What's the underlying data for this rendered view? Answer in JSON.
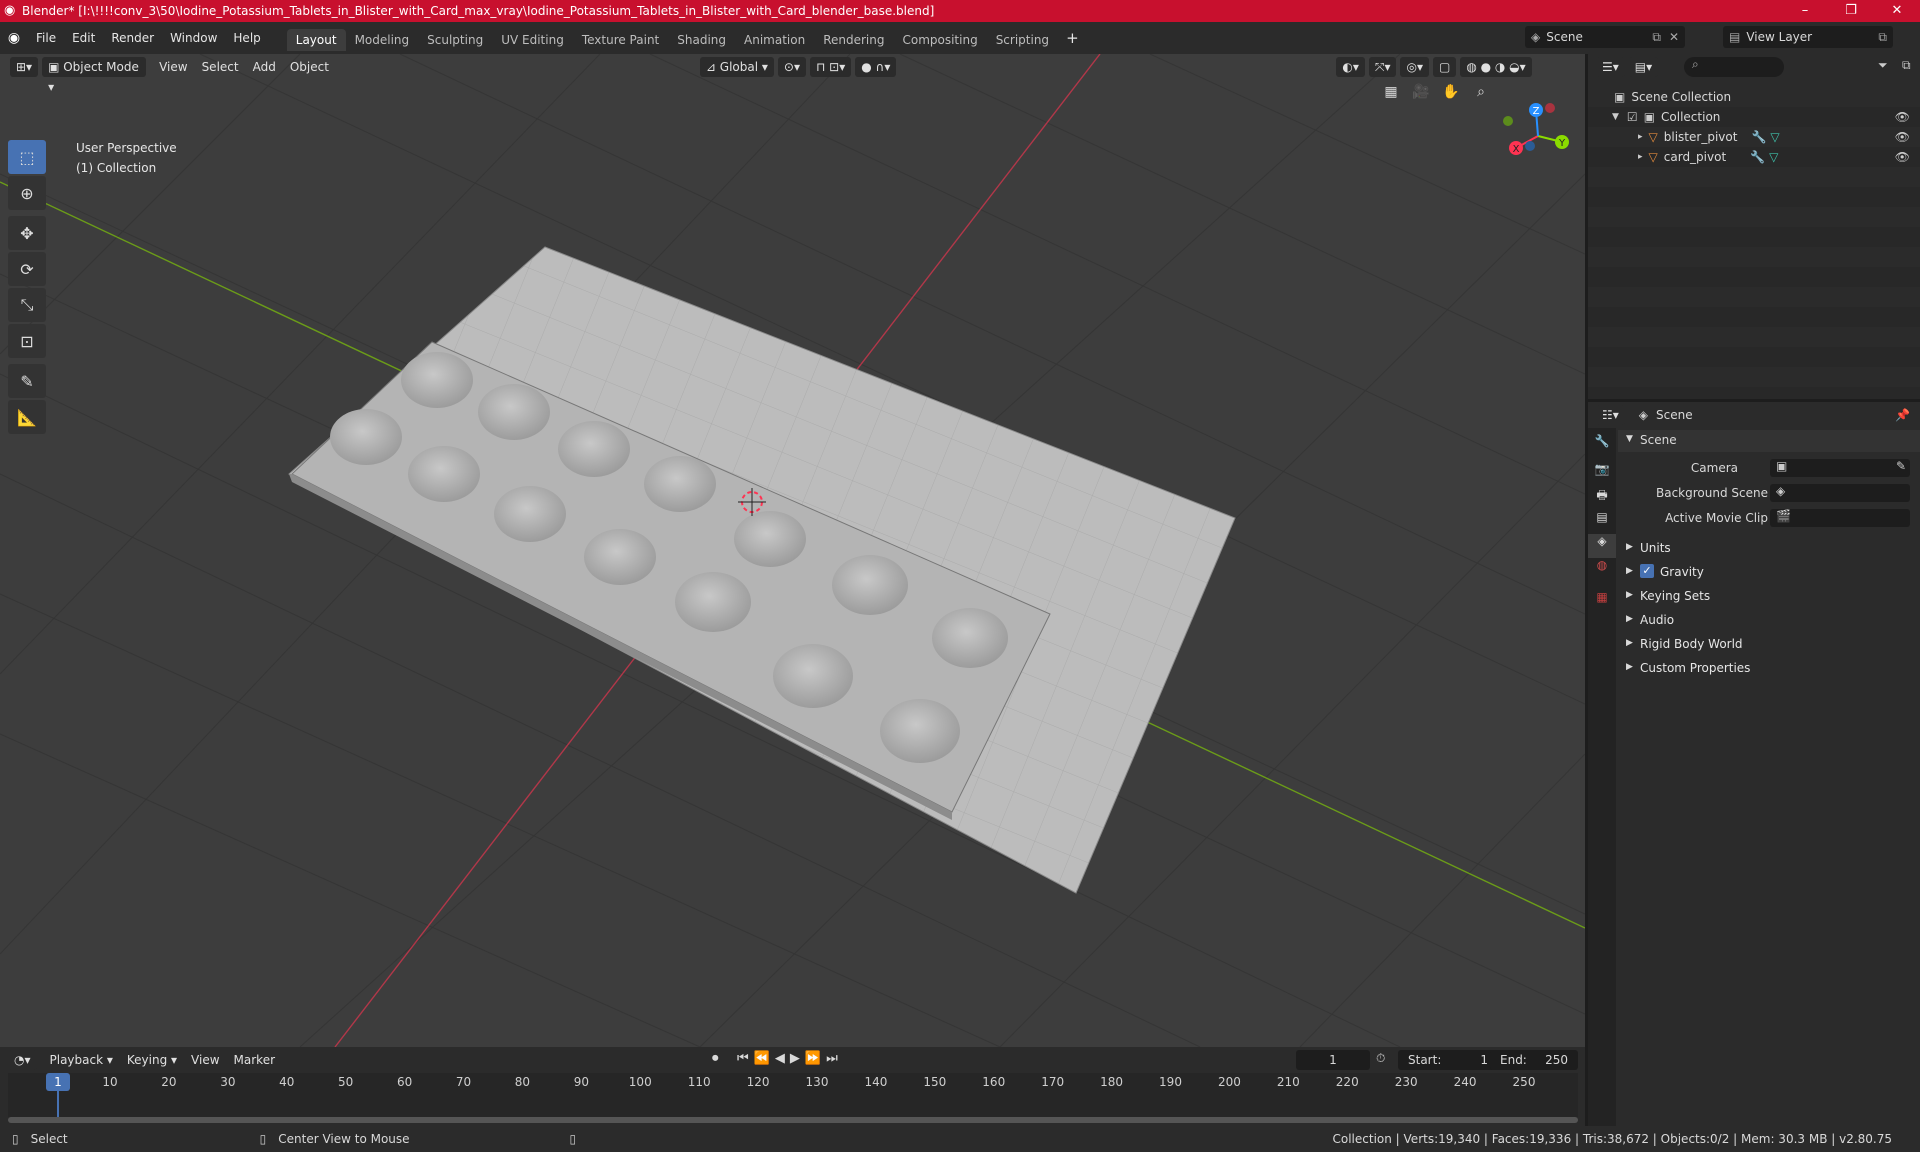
{
  "window": {
    "title": "Blender* [I:\\!!!!conv_3\\50\\Iodine_Potassium_Tablets_in_Blister_with_Card_max_vray\\Iodine_Potassium_Tablets_in_Blister_with_Card_blender_base.blend]",
    "controls": [
      "–",
      "❐",
      "✕"
    ]
  },
  "menu": [
    "File",
    "Edit",
    "Render",
    "Window",
    "Help"
  ],
  "workspaces": [
    "Layout",
    "Modeling",
    "Sculpting",
    "UV Editing",
    "Texture Paint",
    "Shading",
    "Animation",
    "Rendering",
    "Compositing",
    "Scripting"
  ],
  "active_workspace": "Layout",
  "scene_selector": "Scene",
  "view_layer": "View Layer",
  "viewport": {
    "mode": "Object Mode",
    "menus": [
      "View",
      "Select",
      "Add",
      "Object"
    ],
    "transform_orientation": "Global",
    "info_line1": "User Perspective",
    "info_line2": "(1) Collection",
    "gizmo_axes": [
      "X",
      "Y",
      "Z"
    ]
  },
  "outliner": {
    "root": "Scene Collection",
    "collection": "Collection",
    "objects": [
      "blister_pivot",
      "card_pivot"
    ]
  },
  "properties": {
    "context": "Scene",
    "panel": "Scene",
    "fields": [
      "Camera",
      "Background Scene",
      "Active Movie Clip"
    ],
    "sections": [
      "Units",
      "Gravity",
      "Keying Sets",
      "Audio",
      "Rigid Body World",
      "Custom Properties"
    ],
    "gravity_checked": true
  },
  "timeline": {
    "menus": [
      "Playback",
      "Keying",
      "View",
      "Marker"
    ],
    "current_frame": "1",
    "start_label": "Start:",
    "start": "1",
    "end_label": "End:",
    "end": "250",
    "ticks": [
      "1",
      "10",
      "20",
      "30",
      "40",
      "50",
      "60",
      "70",
      "80",
      "90",
      "100",
      "110",
      "120",
      "130",
      "140",
      "150",
      "160",
      "170",
      "180",
      "190",
      "200",
      "210",
      "220",
      "230",
      "240",
      "250"
    ]
  },
  "status": {
    "left": "Select",
    "middle": "Center View to Mouse",
    "right": "Collection | Verts:19,340 | Faces:19,336 | Tris:38,672 | Objects:0/2 | Mem: 30.3 MB | v2.80.75"
  },
  "colors": {
    "titlebar": "#c8102e",
    "active_tool": "#4772b3",
    "x_axis": "#ff3352",
    "y_axis": "#8bdc00",
    "z_axis": "#2890ff"
  }
}
